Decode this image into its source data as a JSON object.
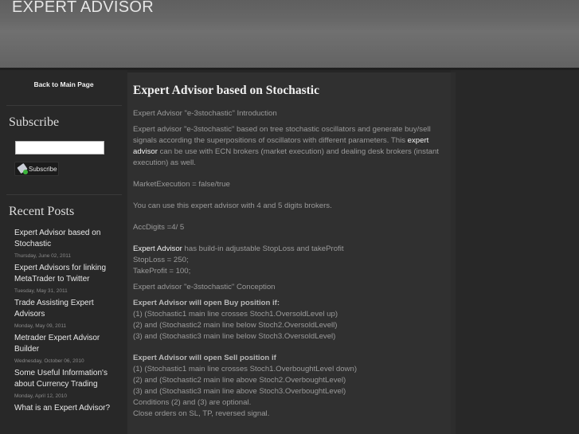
{
  "header": {
    "site_title": "EXPERT ADVISOR"
  },
  "sidebar": {
    "back_link": "Back to Main Page",
    "subscribe": {
      "title": "Subscribe",
      "input_value": "",
      "button_label": "Subscribe"
    },
    "recent_posts": {
      "title": "Recent Posts",
      "items": [
        {
          "title": "Expert Advisor based on Stochastic",
          "date": "Thursday, June 02, 2011"
        },
        {
          "title": "Expert Advisors for linking MetaTrader to Twitter",
          "date": "Tuesday, May 31, 2011"
        },
        {
          "title": "Trade Assisting Expert Advisors",
          "date": "Monday, May 09, 2011"
        },
        {
          "title": "Metrader Expert Advisor Builder",
          "date": "Wednesday, October 06, 2010"
        },
        {
          "title": "Some Useful Information's about Currency Trading",
          "date": "Monday, April 12, 2010"
        },
        {
          "title": "What is an Expert Advisor?",
          "date": ""
        }
      ]
    }
  },
  "post": {
    "heading": "Expert Advisor based on Stochastic",
    "intro_label": "Expert Advisor \"e-3stochastic\" Introduction",
    "para1_a": "Expert advisor \"e-3stochastic\" based on tree stochastic oscillators and generate buy/sell signals according the superpositions of oscillators with different parameters. This ",
    "para1_link": "expert advisor",
    "para1_b": " can be use with ECN brokers (market execution) and dealing desk brokers (instant execution) as well.",
    "market_execution": "MarketExecution = false/true",
    "digits_note": "You can use this expert advisor with 4 and 5 digits brokers.",
    "acc_digits": "AccDigits =4/ 5",
    "sl_tp_link": "Expert Advisor",
    "sl_tp_text": " has build-in  adjustable  StopLoss and takeProfit",
    "stoploss": "StopLoss = 250;",
    "takeprofit": "TakeProfit = 100;",
    "conception_label": "Expert advisor \"e-3stochastic\" Conception",
    "buy_heading": "Expert Advisor will open Buy position if:",
    "buy_conditions": [
      "(1) (Stochastic1 main line crosses Stoch1.OversoldLevel up)",
      "(2) and (Stochastic2 main line below Stoch2.OversoldLevell)",
      "(3) and (Stochastic3 main line below Stoch3.OversoldLevel)"
    ],
    "sell_heading": "Expert Advisor will open Sell position if",
    "sell_conditions": [
      "(1) (Stochastic1 main line crosses Stoch1.OverboughtLevel down)",
      "(2) and (Stochastic2 main line above Stoch2.OverboughtLevel)",
      "(3) and (Stochastic3 main line above Stoch3.OverboughtLevel)"
    ],
    "optional_note": "Conditions (2) and (3) are optional.",
    "close_note": "Close orders on SL, TP, reversed signal."
  }
}
